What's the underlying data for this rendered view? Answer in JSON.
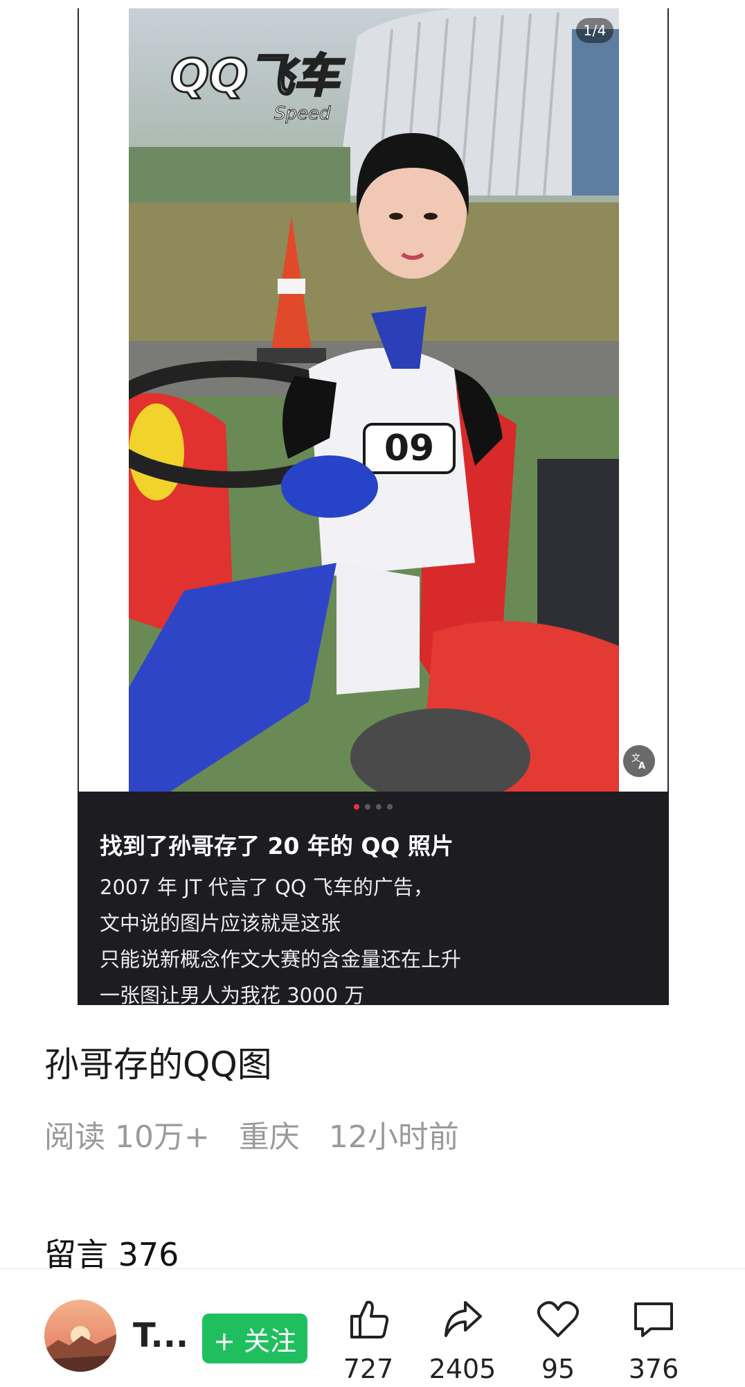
{
  "post": {
    "page_counter": "1/4",
    "image_logo_text": "QQ飞车",
    "image_logo_sub": "Speed",
    "jersey_number": "09",
    "carousel": {
      "total": 4,
      "active": 1
    },
    "caption_title": "找到了孙哥存了 20 年的 QQ 照片",
    "caption_lines": [
      "2007 年 JT 代言了 QQ 飞车的广告，",
      "文中说的图片应该就是这张",
      "只能说新概念作文大赛的含金量还在上升",
      "一张图让男人为我花 3000 万"
    ]
  },
  "article": {
    "title": "孙哥存的QQ图",
    "reads": "阅读 10万+",
    "location": "重庆",
    "time": "12小时前"
  },
  "comments": {
    "heading": "留言 376"
  },
  "bottom_bar": {
    "author_name": "T...",
    "follow_label": "+ 关注",
    "like_count": "727",
    "share_count": "2405",
    "favorite_count": "95",
    "comment_count": "376",
    "accent_color": "#1fbf5f"
  },
  "icons": [
    "translate-icon",
    "like-icon",
    "share-icon",
    "heart-icon",
    "comment-icon"
  ]
}
